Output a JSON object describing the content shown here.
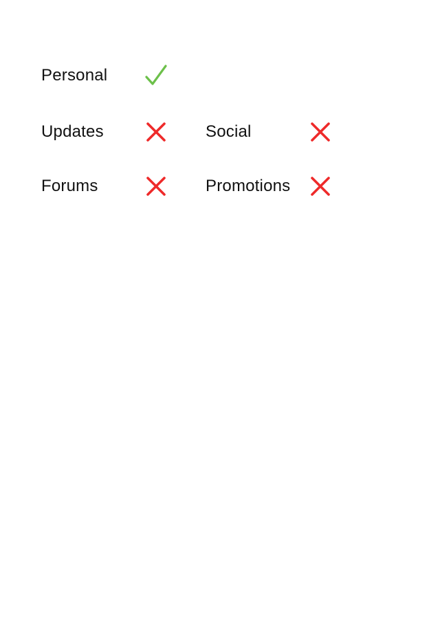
{
  "colors": {
    "check": "#6cc04a",
    "cross": "#ee2a2a",
    "text": "#111111",
    "background": "#ffffff"
  },
  "categories": [
    {
      "label": "Personal",
      "status": "enabled",
      "icon": "checkmark-icon"
    },
    {
      "label": "Updates",
      "status": "disabled",
      "icon": "cross-icon"
    },
    {
      "label": "Social",
      "status": "disabled",
      "icon": "cross-icon"
    },
    {
      "label": "Forums",
      "status": "disabled",
      "icon": "cross-icon"
    },
    {
      "label": "Promotions",
      "status": "disabled",
      "icon": "cross-icon"
    }
  ]
}
